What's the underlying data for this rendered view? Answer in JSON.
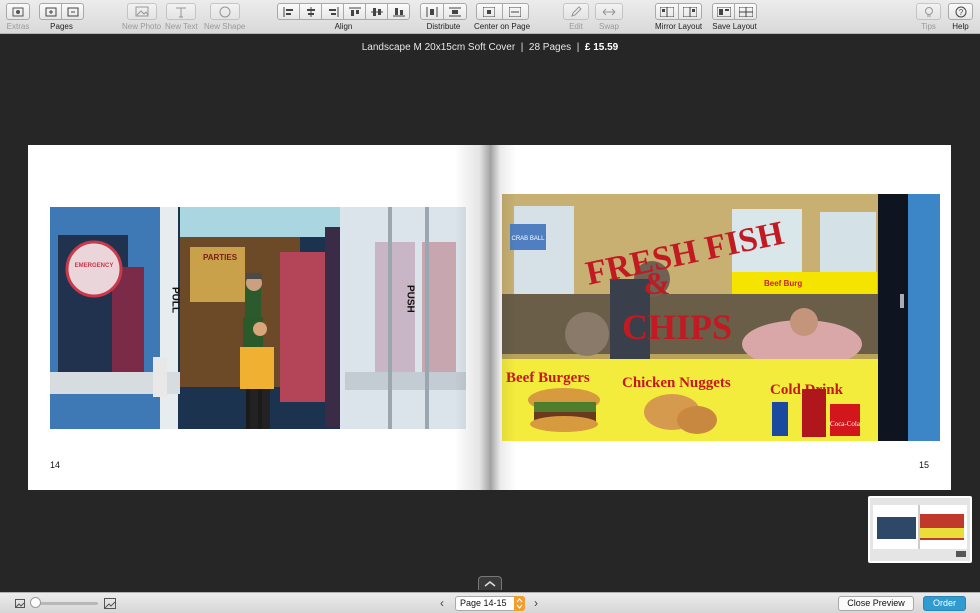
{
  "toolbar": {
    "extras": "Extras",
    "pages": "Pages",
    "new_photo": "New Photo",
    "new_text": "New Text",
    "new_shape": "New Shape",
    "align": "Align",
    "distribute": "Distribute",
    "center_on_page": "Center on Page",
    "edit": "Edit",
    "swap": "Swap",
    "mirror_layout": "Mirror Layout",
    "save_layout": "Save Layout",
    "tips": "Tips",
    "help": "Help"
  },
  "book_info": {
    "format": "Landscape M 20x15cm Soft Cover",
    "pages": "28 Pages",
    "price": "£ 15.59"
  },
  "spread": {
    "left_page_number": "14",
    "right_page_number": "15",
    "left_photo_text": {
      "pull": "PULL",
      "push": "PUSH",
      "sticker": "EMERGENCY",
      "partys": "PARTIES"
    },
    "right_photo_text": {
      "title_line1": "FRESH FISH",
      "title_amp": "&",
      "title_line2": "CHIPS",
      "beef_burgers": "Beef Burgers",
      "chicken_nuggets": "Chicken Nuggets",
      "cold_drinks": "Cold Drink",
      "beef_burgers_small": "Beef Burg",
      "crab_sticker": "CRAB BALL",
      "cola": "Coca-Cola"
    }
  },
  "bottombar": {
    "page_selector": "Page 14-15",
    "prev": "‹",
    "next": "›",
    "close_preview": "Close Preview",
    "order": "Order"
  },
  "colors": {
    "accent": "#2f9bd0",
    "spinner": "#f0a030",
    "canvas": "#262626"
  }
}
